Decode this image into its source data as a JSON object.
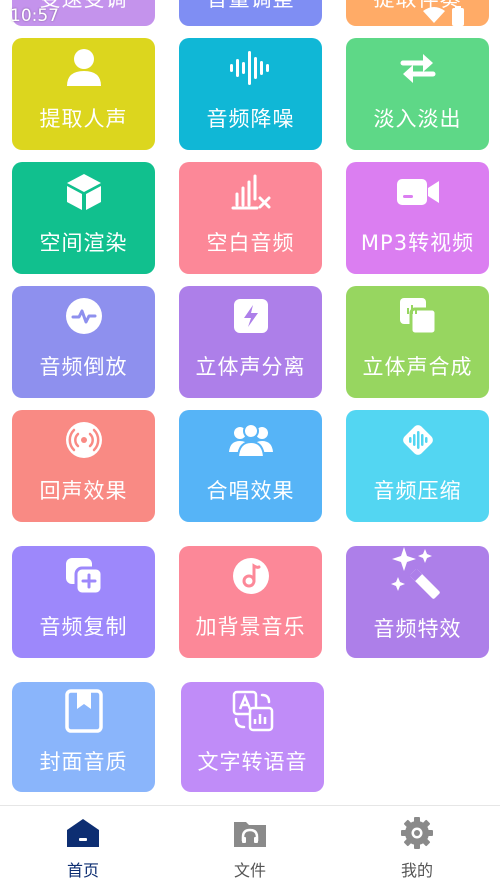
{
  "status_bar": {
    "time": "10:57"
  },
  "colors": {
    "yellow": "#dcd61e",
    "cyan": "#10b7d6",
    "green": "#5ed887",
    "teal": "#11c08e",
    "pink": "#fc8898",
    "violet": "#db7ef1",
    "periwinkle": "#8e90ee",
    "purple": "#ad7fe9",
    "lime": "#97d660",
    "salmon": "#f98a84",
    "sky": "#56b4f7",
    "aqua": "#53d6f2",
    "lavender": "#9d88fb",
    "lightblue": "#8ab5fb",
    "orange": "#ffab67",
    "nav_active": "#0d2e72",
    "nav_inactive": "#757575"
  },
  "top_row_partial": [
    {
      "label": "变速变调",
      "icon": "speed-icon"
    },
    {
      "label": "音量调整",
      "icon": "volume-icon"
    },
    {
      "label": "提取伴奏",
      "icon": "accompaniment-icon"
    }
  ],
  "tiles": [
    {
      "label": "提取人声",
      "icon": "person-icon"
    },
    {
      "label": "音频降噪",
      "icon": "waveform-icon"
    },
    {
      "label": "淡入淡出",
      "icon": "swap-arrows-icon"
    },
    {
      "label": "空间渲染",
      "icon": "cube-icon"
    },
    {
      "label": "空白音频",
      "icon": "bars-x-icon"
    },
    {
      "label": "MP3转视频",
      "icon": "video-camera-icon"
    },
    {
      "label": "音频倒放",
      "icon": "pulse-icon"
    },
    {
      "label": "立体声分离",
      "icon": "lightning-icon"
    },
    {
      "label": "立体声合成",
      "icon": "stacked-squares-icon"
    },
    {
      "label": "回声效果",
      "icon": "broadcast-icon"
    },
    {
      "label": "合唱效果",
      "icon": "group-icon"
    },
    {
      "label": "音频压缩",
      "icon": "diamond-wave-icon"
    },
    {
      "label": "音频复制",
      "icon": "copy-plus-icon"
    },
    {
      "label": "加背景音乐",
      "icon": "music-disc-icon"
    },
    {
      "label": "音频特效",
      "icon": "magic-wand-icon"
    },
    {
      "label": "封面音质",
      "icon": "bookmark-book-icon"
    },
    {
      "label": "文字转语音",
      "icon": "text-translate-icon"
    }
  ],
  "bottom_nav": [
    {
      "label": "首页",
      "icon": "home-icon",
      "active": true
    },
    {
      "label": "文件",
      "icon": "folder-headphones-icon",
      "active": false
    },
    {
      "label": "我的",
      "icon": "settings-gear-icon",
      "active": false
    }
  ]
}
